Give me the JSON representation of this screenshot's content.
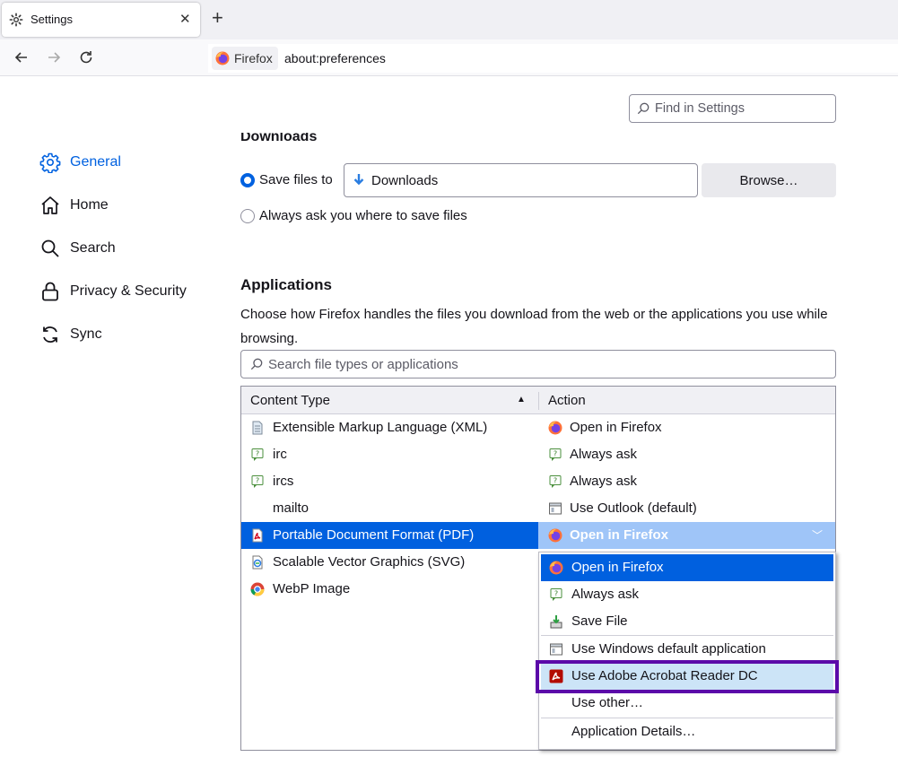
{
  "browser": {
    "tab_title": "Settings",
    "identity_label": "Firefox",
    "url": "about:preferences"
  },
  "search_settings": {
    "placeholder": "Find in Settings"
  },
  "sidebar": {
    "items": [
      {
        "label": "General",
        "icon": "gear-icon",
        "selected": true
      },
      {
        "label": "Home",
        "icon": "home-icon"
      },
      {
        "label": "Search",
        "icon": "search-icon"
      },
      {
        "label": "Privacy & Security",
        "icon": "lock-icon"
      },
      {
        "label": "Sync",
        "icon": "sync-icon"
      }
    ]
  },
  "downloads": {
    "heading": "Downloads",
    "save_files_label": "Save files to",
    "folder": "Downloads",
    "browse_label": "Browse…",
    "always_ask_label": "Always ask you where to save files"
  },
  "applications": {
    "heading": "Applications",
    "description": "Choose how Firefox handles the files you download from the web or the applications you use while browsing.",
    "search_placeholder": "Search file types or applications",
    "columns": {
      "content_type": "Content Type",
      "action": "Action"
    },
    "rows": [
      {
        "type": "Extensible Markup Language (XML)",
        "type_icon": "xml-file-icon",
        "action": "Open in Firefox",
        "action_icon": "firefox-icon"
      },
      {
        "type": "irc",
        "type_icon": "ask-icon",
        "action": "Always ask",
        "action_icon": "ask-icon"
      },
      {
        "type": "ircs",
        "type_icon": "ask-icon",
        "action": "Always ask",
        "action_icon": "ask-icon"
      },
      {
        "type": "mailto",
        "type_icon": "",
        "action": "Use Outlook (default)",
        "action_icon": "app-window-icon"
      },
      {
        "type": "Portable Document Format (PDF)",
        "type_icon": "pdf-icon",
        "action": "Open in Firefox",
        "action_icon": "firefox-icon",
        "selected": true
      },
      {
        "type": "Scalable Vector Graphics (SVG)",
        "type_icon": "svg-file-icon",
        "action": "",
        "action_icon": ""
      },
      {
        "type": "WebP Image",
        "type_icon": "chrome-icon",
        "action": "",
        "action_icon": ""
      }
    ],
    "dropdown": [
      {
        "label": "Open in Firefox",
        "icon": "firefox-icon",
        "state": "active"
      },
      {
        "label": "Always ask",
        "icon": "ask-icon"
      },
      {
        "label": "Save File",
        "icon": "save-file-icon"
      },
      {
        "label": "Use Windows default application",
        "icon": "app-window-icon"
      },
      {
        "label": "Use Adobe Acrobat Reader DC",
        "icon": "acrobat-icon",
        "state": "hover"
      },
      {
        "label": "Use other…",
        "icon": ""
      },
      {
        "label": "Application Details…",
        "icon": ""
      }
    ]
  },
  "colors": {
    "accent": "#0061e0",
    "selection": "#0060df",
    "action_cell_selected": "#9fc5f8",
    "annotation_box": "#5b0aa9"
  }
}
